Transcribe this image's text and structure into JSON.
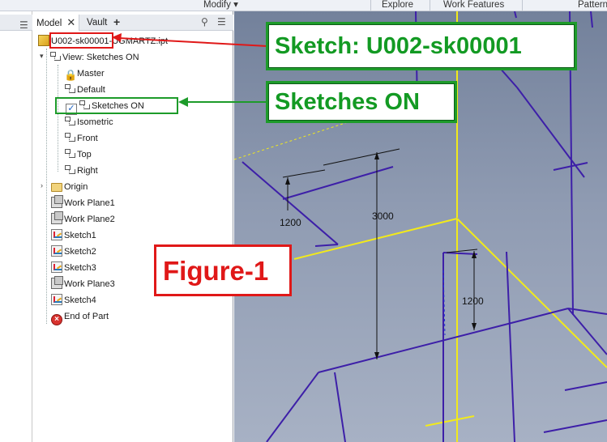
{
  "ribbon": {
    "modify_label": "Modify",
    "modify_caret": "▾",
    "explore_label": "Explore",
    "work_features_label": "Work Features",
    "pattern_label": "Pattern"
  },
  "browser": {
    "tab_model": "Model",
    "tab_vault": "Vault",
    "close_glyph": "✕",
    "plus_glyph": "+",
    "search_glyph": "⚲",
    "menu_glyph": "☰",
    "left_menu_glyph": "☰",
    "tree": {
      "root": "U002-sk00001-UGMARTZ.ipt",
      "view": "View: Sketches ON",
      "master": "Master",
      "default": "Default",
      "sketches_on": "Sketches ON",
      "isometric": "Isometric",
      "front": "Front",
      "top": "Top",
      "right": "Right",
      "origin": "Origin",
      "work_plane1": "Work Plane1",
      "work_plane2": "Work Plane2",
      "sketch1": "Sketch1",
      "sketch2": "Sketch2",
      "sketch3": "Sketch3",
      "work_plane3": "Work Plane3",
      "sketch4": "Sketch4",
      "end_of_part": "End of Part"
    }
  },
  "viewport": {
    "dim_1200_left": "1200",
    "dim_3000": "3000",
    "dim_1200_right": "1200"
  },
  "callouts": {
    "sketch_name": "Sketch: U002-sk00001",
    "sketches_on": "Sketches ON",
    "figure": "Figure-1"
  },
  "colors": {
    "callout_green": "#1d9b2a",
    "callout_red": "#e01818",
    "sketch_purple": "#3d1fa8",
    "axis_yellow": "#f2ea1a"
  }
}
